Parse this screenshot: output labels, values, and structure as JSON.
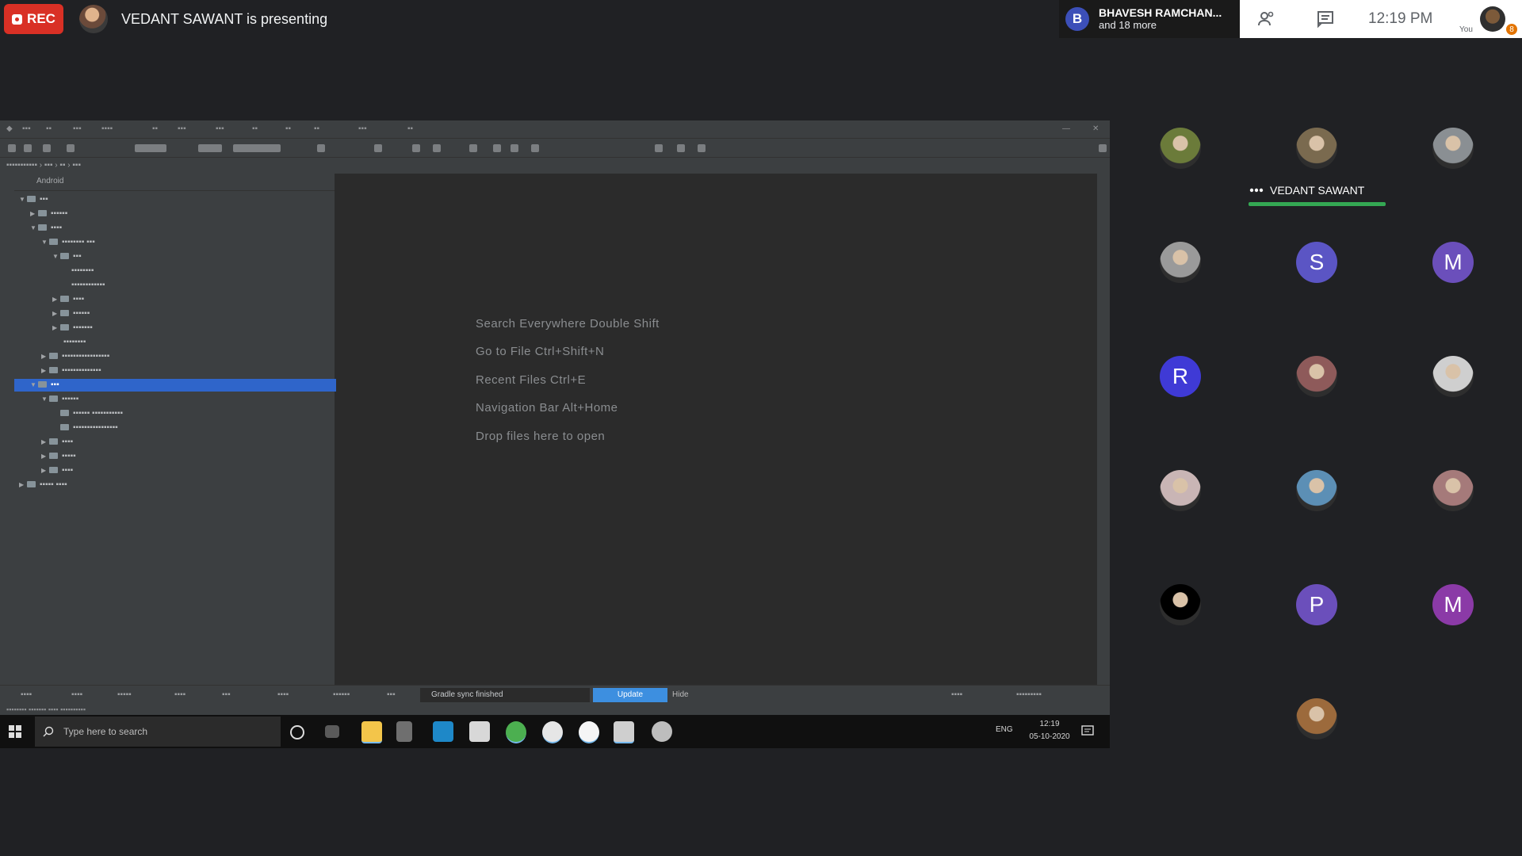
{
  "meeting": {
    "rec_label": "REC",
    "presenting_text": "VEDANT SAWANT is presenting",
    "participants_banner": {
      "avatar_letter": "B",
      "name": "BHAVESH RAMCHAN...",
      "more": "and 18 more"
    },
    "clock": "12:19 PM",
    "self_label": "You",
    "self_badge": "8",
    "active_speaker": "VEDANT SAWANT",
    "participants": [
      {
        "letter": "",
        "color": "#6b7b3a"
      },
      {
        "letter": "",
        "color": "#7a6a4f"
      },
      {
        "letter": "",
        "color": "#8a8f93"
      },
      {
        "letter": "",
        "color": "#9a9a9a"
      },
      {
        "letter": "S",
        "color": "#5b55c4"
      },
      {
        "letter": "M",
        "color": "#6b4fbb"
      },
      {
        "letter": "R",
        "color": "#3f3ad6"
      },
      {
        "letter": "",
        "color": "#8e5a5a"
      },
      {
        "letter": "",
        "color": "#cfcfcf"
      },
      {
        "letter": "",
        "color": "#c9b5b5"
      },
      {
        "letter": "",
        "color": "#5c8fb5"
      },
      {
        "letter": "",
        "color": "#a57a7a"
      },
      {
        "letter": "",
        "color": "#000000"
      },
      {
        "letter": "P",
        "color": "#6b4fbb"
      },
      {
        "letter": "M",
        "color": "#8b3aa7"
      },
      {
        "letter": "",
        "color": "#9c6a3c"
      }
    ]
  },
  "ide": {
    "project_title": "Android",
    "editor_hints": [
      "Search Everywhere Double Shift",
      "Go to File Ctrl+Shift+N",
      "Recent Files Ctrl+E",
      "Navigation Bar Alt+Home",
      "Drop files here to open"
    ],
    "notification_text": "Gradle sync finished",
    "notification_action": "Update",
    "notification_close": "Hide"
  },
  "taskbar": {
    "search_placeholder": "Type here to search",
    "tray_lang": "ENG",
    "tray_time": "12:19",
    "tray_date": "05-10-2020"
  },
  "colors": {
    "rec_red": "#d93025",
    "speaker_green": "#34a853",
    "ide_selection": "#2f65ca",
    "meet_background": "#202124"
  }
}
